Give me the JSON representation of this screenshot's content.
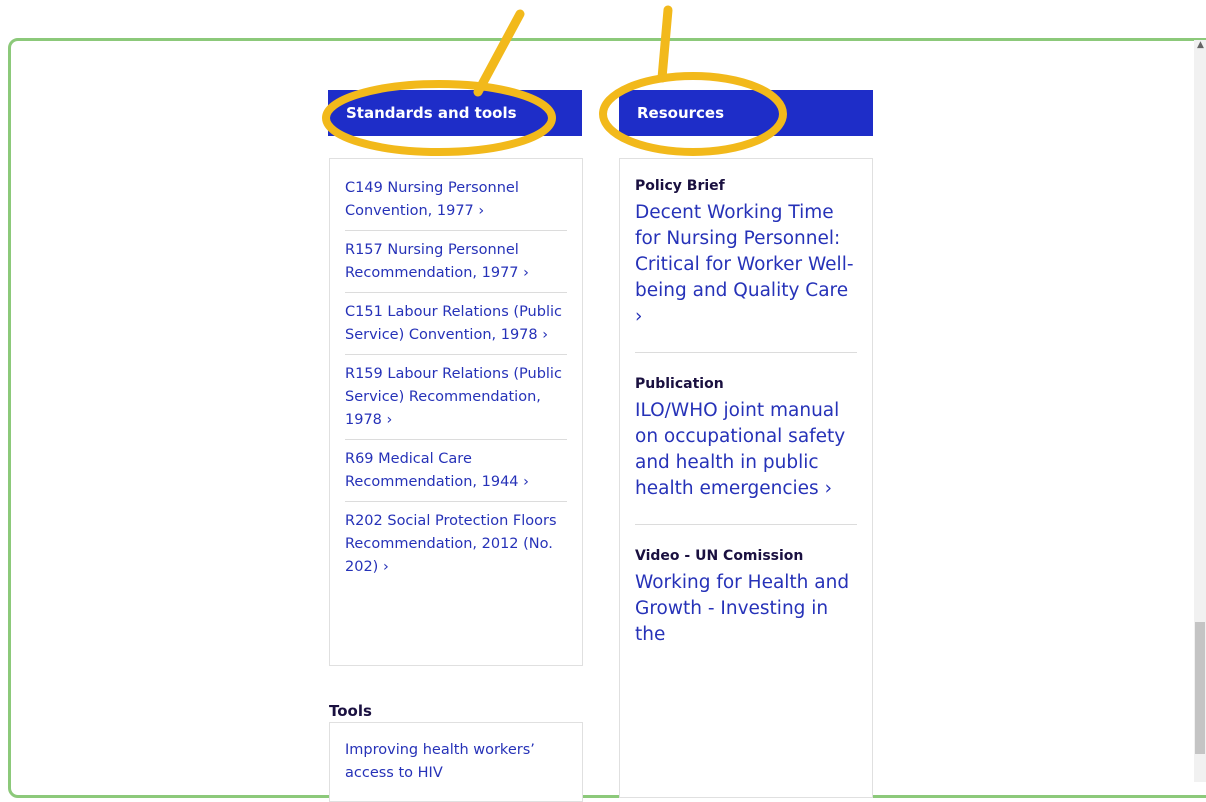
{
  "standards": {
    "header": "Standards and tools",
    "items": [
      "C149 Nursing Personnel Convention, 1977 ›",
      "R157 Nursing Personnel Recommendation, 1977 ›",
      "C151 Labour Relations (Public Service) Convention, 1978 ›",
      "R159 Labour Relations (Public Service) Recommendation, 1978 ›",
      "R69 Medical Care Recommendation, 1944 ›",
      "R202 Social Protection Floors Recommendation, 2012 (No. 202) ›"
    ]
  },
  "resources": {
    "header": "Resources",
    "items": [
      {
        "type": "Policy Brief",
        "title": "Decent Working Time for Nursing Personnel: Critical for Worker Well-being and Quality Care ›"
      },
      {
        "type": "Publication",
        "title": "ILO/WHO joint manual on occupational safety and health in public health emergencies ›"
      },
      {
        "type": "Video - UN Comission",
        "title": "Working for Health and Growth - Investing in the"
      }
    ]
  },
  "tools": {
    "heading": "Tools",
    "item": "Improving health workers’ access to HIV"
  },
  "colors": {
    "header_bg": "#1e2dc8",
    "link": "#2632b8",
    "annotation": "#f2b91b",
    "frame_border": "#8cc97a"
  }
}
